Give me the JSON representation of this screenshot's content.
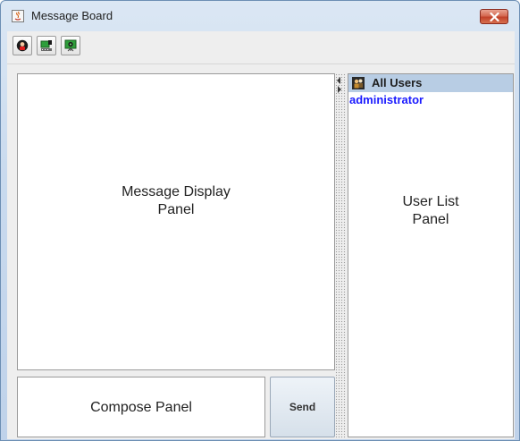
{
  "window": {
    "title": "Message Board",
    "app_icon": "java-cup-icon",
    "close_icon": "close-icon"
  },
  "toolbar": {
    "buttons": [
      {
        "icon": "user-status-icon"
      },
      {
        "icon": "network-computer-icon"
      },
      {
        "icon": "monitor-broadcast-icon"
      }
    ]
  },
  "message_display": {
    "caption": "Message Display\nPanel"
  },
  "compose": {
    "caption": "Compose Panel",
    "send_label": "Send"
  },
  "user_list": {
    "header": "All Users",
    "header_icon": "users-group-icon",
    "users": [
      "administrator"
    ],
    "caption": "User List\nPanel"
  },
  "colors": {
    "header_bg": "#b8cde4",
    "user_link": "#1a1aff",
    "close_red": "#c1432a"
  }
}
